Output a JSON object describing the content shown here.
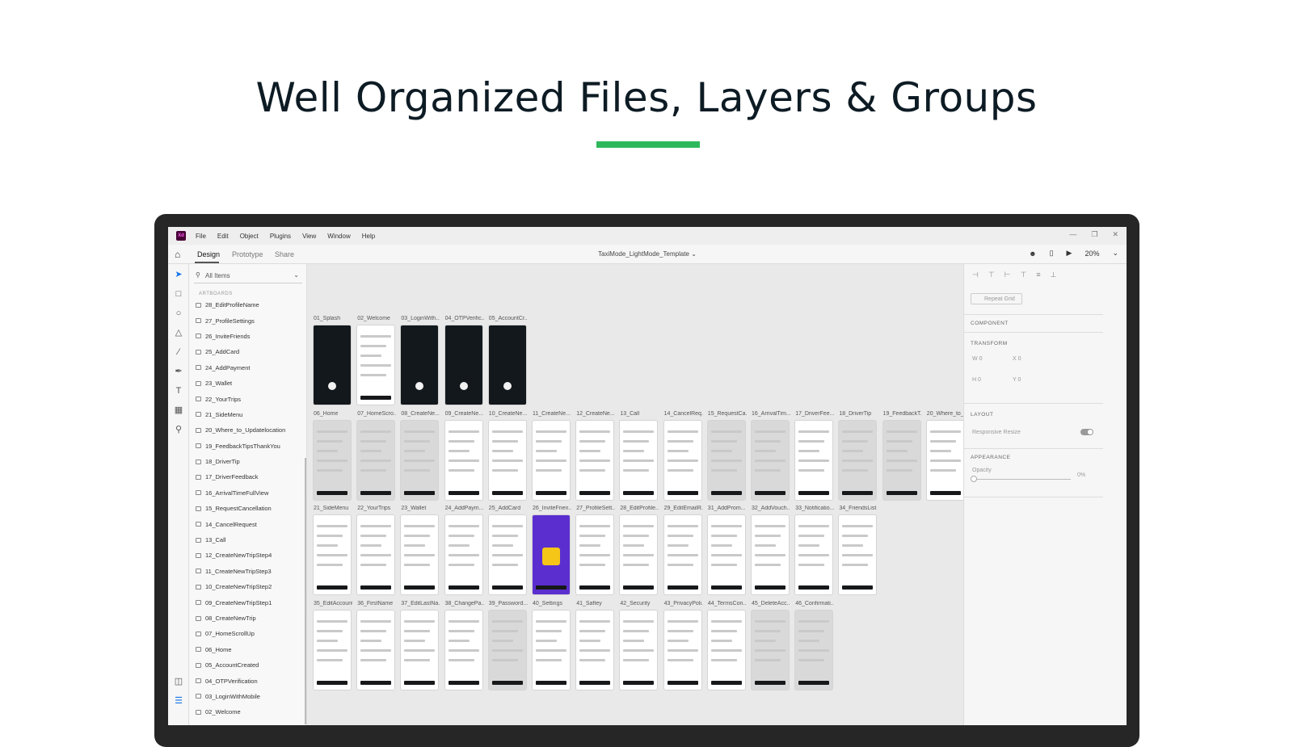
{
  "hero": {
    "title": "Well Organized Files, Layers & Groups"
  },
  "app": {
    "logo": "Xd",
    "menu": [
      "File",
      "Edit",
      "Object",
      "Plugins",
      "View",
      "Window",
      "Help"
    ],
    "tabs": [
      "Design",
      "Prototype",
      "Share"
    ],
    "document_title": "TaxiMode_LightMode_Template",
    "zoom": "20%"
  },
  "layers_panel": {
    "search_placeholder": "All Items",
    "section_label": "ARTBOARDS",
    "items": [
      "28_EditProfileName",
      "27_ProfileSettings",
      "26_InviteFriends",
      "25_AddCard",
      "24_AddPayment",
      "23_Wallet",
      "22_YourTrips",
      "21_SideMenu",
      "20_Where_to_Updatelocation",
      "19_FeedbackTipsThankYou",
      "18_DriverTip",
      "17_DriverFeedback",
      "16_ArrivalTimeFullView",
      "15_RequestCancellation",
      "14_CancelRequest",
      "13_Call",
      "12_CreateNewTripStep4",
      "11_CreateNewTripStep3",
      "10_CreateNewTripStep2",
      "09_CreateNewTripStep1",
      "08_CreateNewTrip",
      "07_HomeScrollUp",
      "06_Home",
      "05_AccountCreated",
      "04_OTPVerification",
      "03_LoginWithMobile",
      "02_Welcome"
    ]
  },
  "canvas": {
    "rows": [
      {
        "labels": [
          "01_Splash",
          "02_Welcome",
          "03_LoginWith...",
          "04_OTPVerific...",
          "05_AccountCr..."
        ],
        "styles": [
          "dark",
          "light",
          "dark",
          "dark",
          "dark"
        ]
      },
      {
        "labels": [
          "06_Home",
          "07_HomeScro...",
          "08_CreateNe...",
          "09_CreateNe...",
          "10_CreateNe...",
          "11_CreateNe...",
          "12_CreateNe...",
          "13_Call",
          "14_CancelReq...",
          "15_RequestCa...",
          "16_ArrivalTim...",
          "17_DriverFee...",
          "18_DriverTip",
          "19_FeedbackT...",
          "20_Where_to_..."
        ],
        "styles": [
          "gray",
          "gray",
          "gray",
          "light",
          "light",
          "light",
          "light",
          "light",
          "light",
          "gray",
          "gray",
          "light",
          "gray",
          "gray",
          "light"
        ]
      },
      {
        "labels": [
          "21_SideMenu",
          "22_YourTrips",
          "23_Wallet",
          "24_AddPaym...",
          "25_AddCard",
          "26_InviteFrien...",
          "27_ProfileSett...",
          "28_EditProfile...",
          "29_EditEmailR...",
          "31_AddProm...",
          "32_AddVouch...",
          "33_Notificatio...",
          "34_FriendsList"
        ],
        "styles": [
          "light",
          "light",
          "light",
          "light",
          "light",
          "purple",
          "light",
          "light",
          "light",
          "light",
          "light",
          "light",
          "light"
        ]
      },
      {
        "labels": [
          "35_EditAccount",
          "36_FirstName",
          "37_EditLastNa...",
          "38_ChangePa...",
          "39_Password...",
          "40_Settings",
          "41_Saftey",
          "42_Security",
          "43_PrivacyPoli...",
          "44_TermsCon...",
          "45_DeleteAcc...",
          "46_Confirmati..."
        ],
        "styles": [
          "light",
          "light",
          "light",
          "light",
          "gray",
          "light",
          "light",
          "light",
          "light",
          "light",
          "gray",
          "gray"
        ]
      }
    ]
  },
  "properties": {
    "repeat_grid": "Repeat Grid",
    "component": "COMPONENT",
    "transform": "TRANSFORM",
    "w": "W",
    "w_val": "0",
    "x": "X",
    "x_val": "0",
    "h": "H",
    "h_val": "0",
    "y": "Y",
    "y_val": "0",
    "layout": "LAYOUT",
    "responsive_resize": "Responsive Resize",
    "appearance": "APPEARANCE",
    "opacity": "Opacity",
    "opacity_val": "0%"
  },
  "colors": {
    "accent": "#2eb85c",
    "title": "#0d1b24"
  }
}
